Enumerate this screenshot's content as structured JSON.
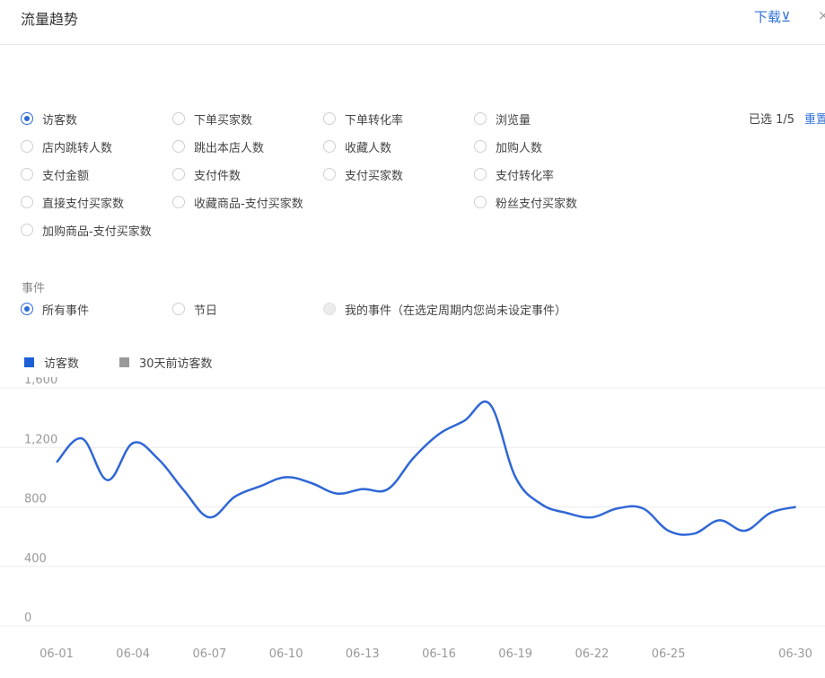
{
  "header": {
    "title": "流量趋势",
    "download_label": "下载⊻",
    "close_glyph": "×"
  },
  "metrics": {
    "selected_count": "已选 1/5",
    "reset_label": "重置",
    "options": [
      {
        "label": "访客数",
        "checked": true
      },
      {
        "label": "下单买家数",
        "checked": false
      },
      {
        "label": "下单转化率",
        "checked": false
      },
      {
        "label": "浏览量",
        "checked": false
      },
      {
        "label": "店内跳转人数",
        "checked": false
      },
      {
        "label": "跳出本店人数",
        "checked": false
      },
      {
        "label": "收藏人数",
        "checked": false
      },
      {
        "label": "加购人数",
        "checked": false
      },
      {
        "label": "支付金额",
        "checked": false
      },
      {
        "label": "支付件数",
        "checked": false
      },
      {
        "label": "支付买家数",
        "checked": false
      },
      {
        "label": "支付转化率",
        "checked": false
      },
      {
        "label": "直接支付买家数",
        "checked": false
      },
      {
        "label": "收藏商品-支付买家数",
        "checked": false
      },
      {
        "label": "粉丝支付买家数",
        "checked": false
      },
      {
        "label": "加购商品-支付买家数",
        "checked": false
      }
    ]
  },
  "events": {
    "title": "事件",
    "options": [
      {
        "label": "所有事件",
        "checked": true,
        "disabled": false
      },
      {
        "label": "节日",
        "checked": false,
        "disabled": false
      },
      {
        "label": "我的事件（在选定周期内您尚未设定事件）",
        "checked": false,
        "disabled": true
      }
    ]
  },
  "legend": [
    {
      "label": "访客数",
      "color": "#1e5fd6"
    },
    {
      "label": "30天前访客数",
      "color": "#999999"
    }
  ],
  "colors": {
    "accent": "#3072d9",
    "line": "#2f67d6",
    "grid": "#ececec"
  },
  "chart_data": {
    "type": "line",
    "ylim": [
      0,
      1600
    ],
    "y_ticks": [
      "1,600",
      "1,200",
      "800",
      "400",
      "0"
    ],
    "x_tick_labels": [
      "06-01",
      "06-04",
      "06-07",
      "06-10",
      "06-13",
      "06-16",
      "06-19",
      "06-22",
      "06-25",
      "06-30"
    ],
    "x": [
      "06-01",
      "06-02",
      "06-03",
      "06-04",
      "06-05",
      "06-06",
      "06-07",
      "06-08",
      "06-09",
      "06-10",
      "06-11",
      "06-12",
      "06-13",
      "06-14",
      "06-15",
      "06-16",
      "06-17",
      "06-18",
      "06-19",
      "06-20",
      "06-21",
      "06-22",
      "06-23",
      "06-24",
      "06-25",
      "06-26",
      "06-27",
      "06-28",
      "06-29",
      "06-30"
    ],
    "series": [
      {
        "name": "访客数",
        "values": [
          1100,
          1260,
          980,
          1230,
          1120,
          910,
          730,
          870,
          940,
          1000,
          960,
          890,
          920,
          920,
          1130,
          1290,
          1380,
          1490,
          1000,
          820,
          760,
          730,
          790,
          790,
          640,
          620,
          710,
          640,
          760,
          800
        ]
      }
    ]
  }
}
